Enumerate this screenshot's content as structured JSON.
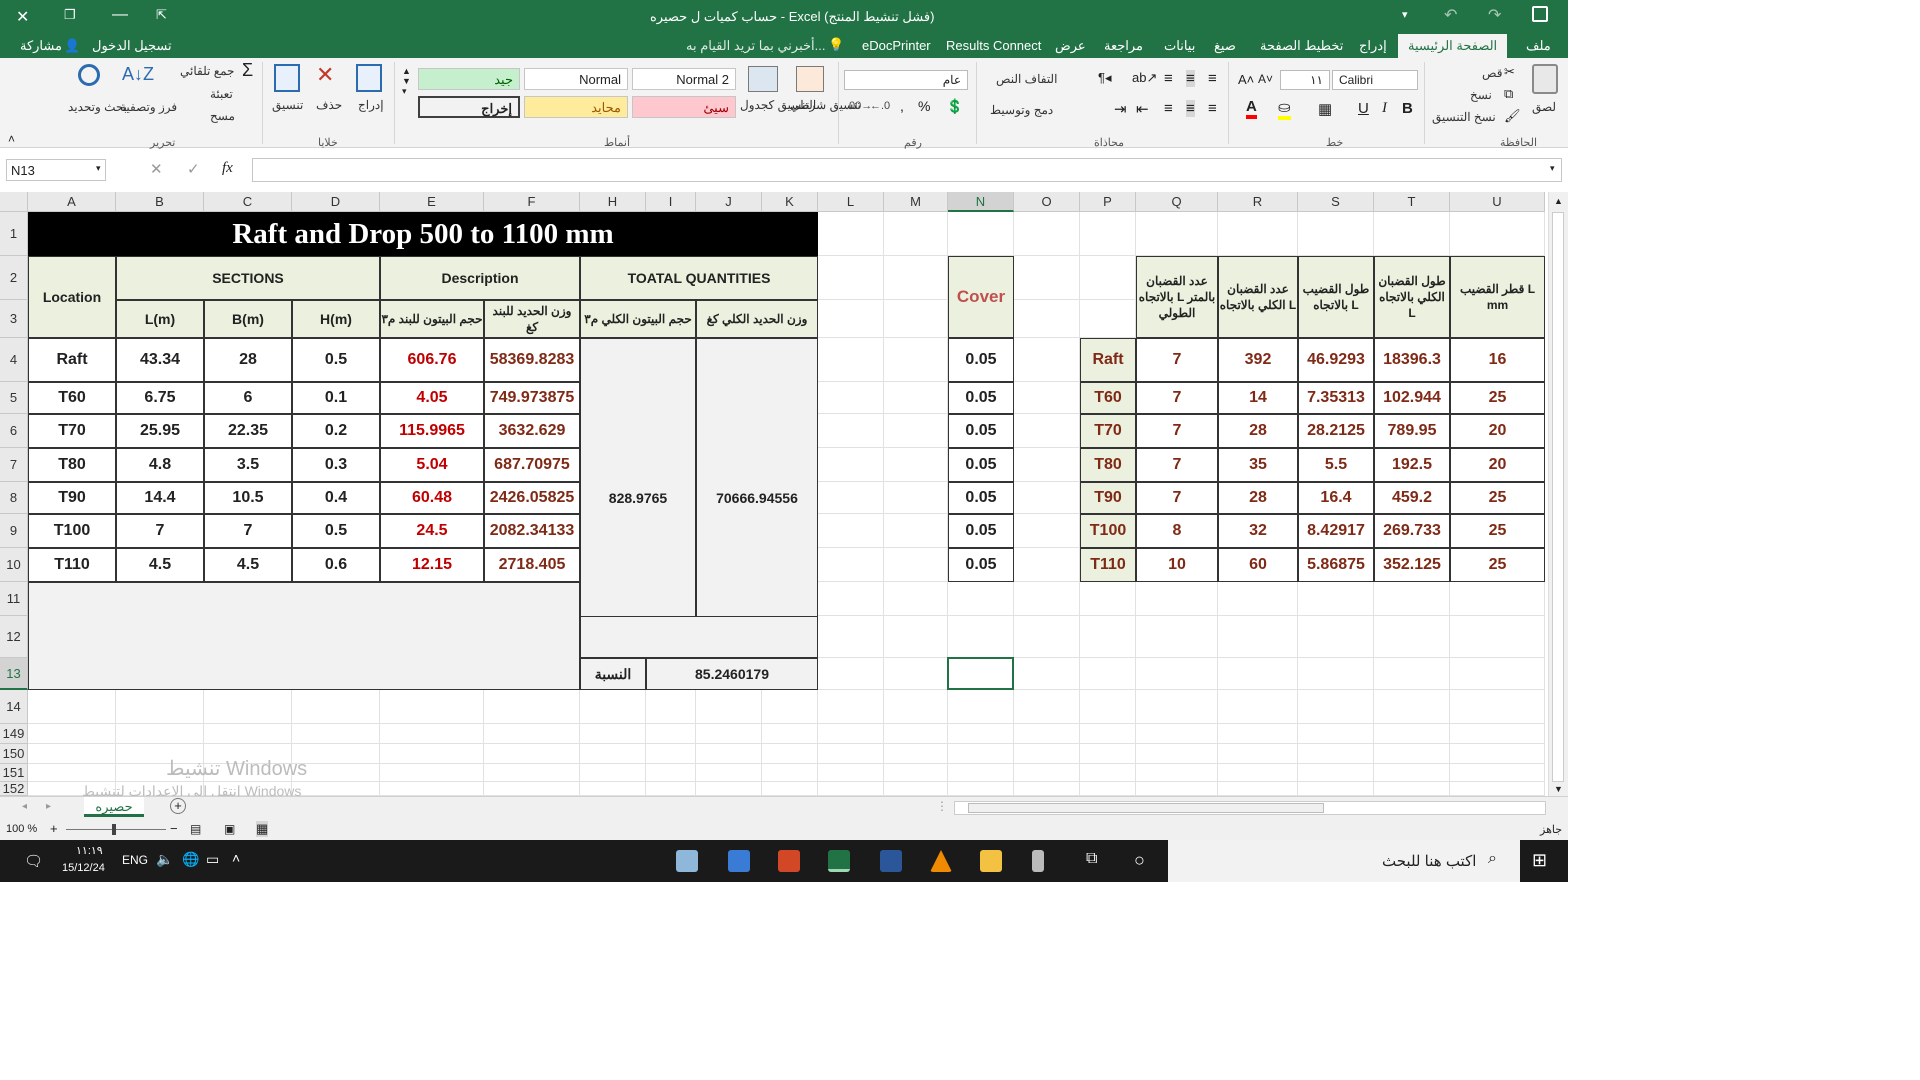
{
  "window": {
    "title": "حساب كميات ل حصيره - Excel (فشل تنشيط المنتج)",
    "save_icon": "save-icon"
  },
  "tabs": [
    "ملف",
    "الصفحة الرئيسية",
    "إدراج",
    "تخطيط الصفحة",
    "صيغ",
    "بيانات",
    "مراجعة",
    "عرض",
    "Results Connect",
    "eDocPrinter"
  ],
  "tell_me": "أخبرني بما تريد القيام به...",
  "sign_in": "تسجيل الدخول",
  "share": "مشاركة",
  "ribbon": {
    "clipboard": {
      "paste": "لصق",
      "cut": "قص",
      "copy": "نسخ",
      "format_painter": "نسخ التنسيق",
      "group": "الحافظة"
    },
    "font": {
      "name": "Calibri",
      "size": "١١",
      "group": "خط"
    },
    "alignment": {
      "wrap": "التفاف النص",
      "merge": "دمج وتوسيط",
      "group": "محاذاة"
    },
    "number": {
      "format": "عام",
      "group": "رقم"
    },
    "styles": {
      "conditional": "تنسيق شرطي",
      "as_table": "التنسيق كجدول",
      "normal2": "Normal 2",
      "normal": "Normal",
      "good": "جيد",
      "bad": "سيئ",
      "neutral": "محايد",
      "output": "إخراج",
      "group": "أنماط"
    },
    "cells": {
      "insert": "إدراج",
      "delete": "حذف",
      "format": "تنسيق",
      "group": "خلايا"
    },
    "editing": {
      "autosum": "جمع تلقائي",
      "fill": "تعبئة",
      "clear": "مسح",
      "sort": "فرز وتصفية",
      "find": "بحث وتحديد",
      "group": "تحرير"
    }
  },
  "name_box": "N13",
  "fx": "fx",
  "columns": [
    "A",
    "B",
    "C",
    "D",
    "E",
    "F",
    "H",
    "I",
    "J",
    "K",
    "L",
    "M",
    "N",
    "O",
    "P",
    "Q",
    "R",
    "S",
    "T",
    "U"
  ],
  "rows": [
    "1",
    "2",
    "3",
    "4",
    "5",
    "6",
    "7",
    "8",
    "9",
    "10",
    "11",
    "12",
    "13",
    "14",
    "149",
    "150",
    "151",
    "152"
  ],
  "main_table": {
    "title": "Raft and Drop 500 to 1100 mm",
    "h_location": "Location",
    "h_sections": "SECTIONS",
    "h_description": "Description",
    "h_totals": "TOATAL QUANTITIES",
    "h_l": "L(m)",
    "h_b": "B(m)",
    "h_h": "H(m)",
    "h_conc_item": "حجم البيتون للبند م٣",
    "h_steel_item": "وزن الحديد للبند كغ",
    "h_conc_total": "حجم البيتون الكلي م٣",
    "h_steel_total": "وزن الحديد الكلي كغ",
    "rows": [
      {
        "loc": "Raft",
        "l": "43.34",
        "b": "28",
        "h": "0.5",
        "conc": "606.76",
        "steel": "58369.8283"
      },
      {
        "loc": "T60",
        "l": "6.75",
        "b": "6",
        "h": "0.1",
        "conc": "4.05",
        "steel": "749.973875"
      },
      {
        "loc": "T70",
        "l": "25.95",
        "b": "22.35",
        "h": "0.2",
        "conc": "115.9965",
        "steel": "3632.629"
      },
      {
        "loc": "T80",
        "l": "4.8",
        "b": "3.5",
        "h": "0.3",
        "conc": "5.04",
        "steel": "687.70975"
      },
      {
        "loc": "T90",
        "l": "14.4",
        "b": "10.5",
        "h": "0.4",
        "conc": "60.48",
        "steel": "2426.05825"
      },
      {
        "loc": "T100",
        "l": "7",
        "b": "7",
        "h": "0.5",
        "conc": "24.5",
        "steel": "2082.34133"
      },
      {
        "loc": "T110",
        "l": "4.5",
        "b": "4.5",
        "h": "0.6",
        "conc": "12.15",
        "steel": "2718.405"
      }
    ],
    "total_conc": "828.9765",
    "total_steel": "70666.94556",
    "ratio_label": "النسبة",
    "ratio_value": "85.2460179"
  },
  "cover": {
    "header": "Cover",
    "values": [
      "0.05",
      "0.05",
      "0.05",
      "0.05",
      "0.05",
      "0.05",
      "0.05"
    ]
  },
  "rebar_table": {
    "h_bars_per_m": "عدد القضبان بالاتجاه L بالمتر الطولي",
    "h_total_bars": "عدد القضبان الكلي بالاتجاه L",
    "h_bar_len": "طول القضيب بالاتجاه L",
    "h_total_len": "طول القضبان الكلي بالاتجاه L",
    "h_dia": "قطر القضيب L mm",
    "rows": [
      {
        "loc": "Raft",
        "n": "7",
        "total": "392",
        "len": "46.9293",
        "tlen": "18396.3",
        "dia": "16"
      },
      {
        "loc": "T60",
        "n": "7",
        "total": "14",
        "len": "7.35313",
        "tlen": "102.944",
        "dia": "25"
      },
      {
        "loc": "T70",
        "n": "7",
        "total": "28",
        "len": "28.2125",
        "tlen": "789.95",
        "dia": "20"
      },
      {
        "loc": "T80",
        "n": "7",
        "total": "35",
        "len": "5.5",
        "tlen": "192.5",
        "dia": "20"
      },
      {
        "loc": "T90",
        "n": "7",
        "total": "28",
        "len": "16.4",
        "tlen": "459.2",
        "dia": "25"
      },
      {
        "loc": "T100",
        "n": "8",
        "total": "32",
        "len": "8.42917",
        "tlen": "269.733",
        "dia": "25"
      },
      {
        "loc": "T110",
        "n": "10",
        "total": "60",
        "len": "5.86875",
        "tlen": "352.125",
        "dia": "25"
      }
    ]
  },
  "sheet_tab": "حصيره",
  "watermark": {
    "line1": "تنشيط Windows",
    "line2": "انتقل إلى الإعدادات لتنشيط Windows"
  },
  "status": {
    "ready": "جاهز",
    "zoom": "100 %"
  },
  "taskbar": {
    "search": "اكتب هنا للبحث",
    "lang": "ENG",
    "time": "١١:١٩",
    "date": "15/12/24"
  }
}
